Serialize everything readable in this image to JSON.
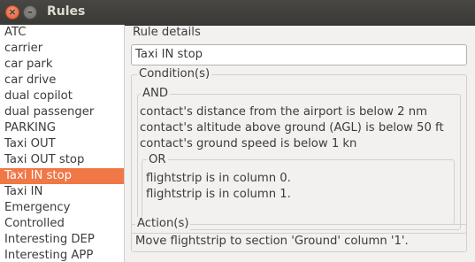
{
  "window": {
    "title": "Rules"
  },
  "rules_list": {
    "items": [
      "ATC",
      "carrier",
      "car park",
      "car drive",
      "dual copilot",
      "dual passenger",
      "PARKING",
      "Taxi OUT",
      "Taxi OUT stop",
      "Taxi IN stop",
      "Taxi IN",
      "Emergency",
      "Controlled",
      "Interesting DEP",
      "Interesting APP"
    ],
    "selected": "Taxi IN stop"
  },
  "details": {
    "section_label": "Rule details",
    "name_value": "Taxi IN stop",
    "conditions_label": "Condition(s)",
    "and_label": "AND",
    "and_conditions": [
      "contact's distance from the airport is below 2 nm",
      "contact's altitude above ground (AGL) is below 50 ft",
      "contact's ground speed is below 1 kn"
    ],
    "or_label": "OR",
    "or_conditions": [
      "flightstrip is  in column 0.",
      "flightstrip is  in column 1."
    ],
    "actions_label": "Action(s)",
    "action_text": "Move flightstrip to section 'Ground' column '1'."
  },
  "colors": {
    "selection": "#f07746",
    "titlebar": "#3d3c38"
  }
}
